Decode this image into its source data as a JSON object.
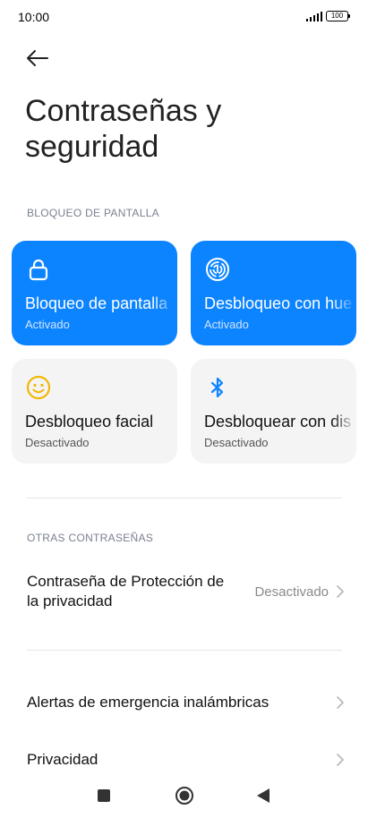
{
  "status_bar": {
    "time": "10:00",
    "battery": "100"
  },
  "page": {
    "title": "Contraseñas y seguridad"
  },
  "screen_lock_section": {
    "label": "BLOQUEO DE PANTALLA",
    "tiles": [
      {
        "title": "Bloqueo de pantalla",
        "status": "Activado",
        "icon": "lock-icon"
      },
      {
        "title": "Desbloqueo con huella",
        "status": "Activado",
        "icon": "fingerprint-icon"
      },
      {
        "title": "Desbloqueo facial",
        "status": "Desactivado",
        "icon": "face-icon"
      },
      {
        "title": "Desbloquear con dispositivo",
        "status": "Desactivado",
        "icon": "bluetooth-icon"
      }
    ]
  },
  "other_passwords_section": {
    "label": "OTRAS CONTRASEÑAS",
    "privacy_password": {
      "label": "Contraseña de Protección de la privacidad",
      "value": "Desactivado"
    }
  },
  "menu": {
    "emergency_alerts": "Alertas de emergencia inalámbricas",
    "privacy": "Privacidad"
  },
  "colors": {
    "accent": "#0d84ff",
    "face_icon": "#f2b705"
  },
  "navbar": {
    "icons": [
      "recents-icon",
      "home-icon",
      "back-icon"
    ]
  }
}
